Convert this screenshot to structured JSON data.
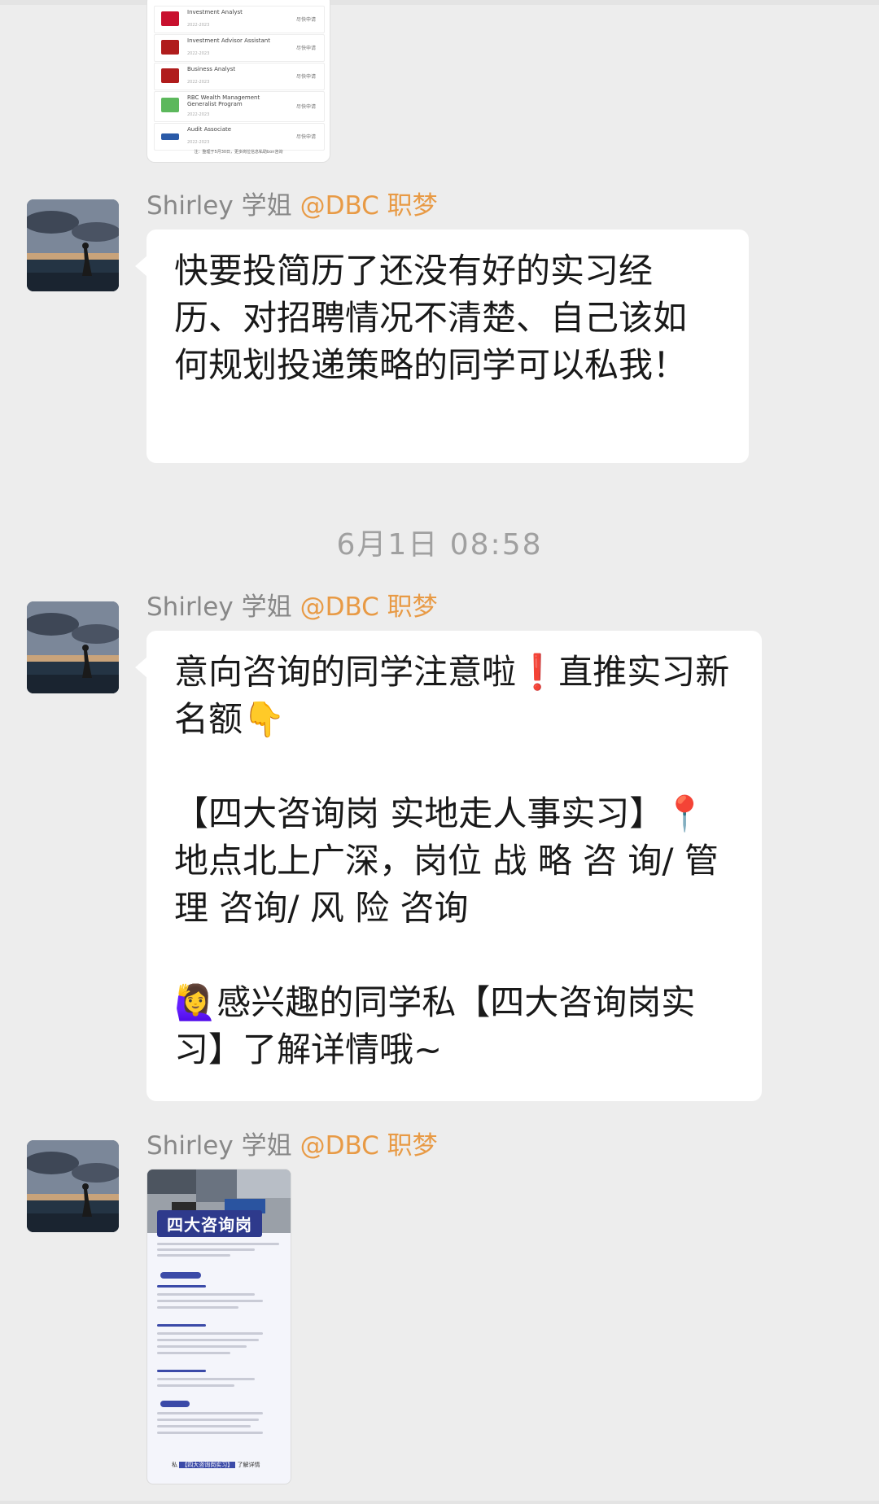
{
  "top_card": {
    "rows": [
      {
        "title": "Investment Analyst",
        "sub": "2022-2023",
        "action": "尽快申请",
        "logo_color": "#c8102e"
      },
      {
        "title": "Investment Advisor Assistant",
        "sub": "2022-2023",
        "action": "尽快申请",
        "logo_color": "#b01c1c"
      },
      {
        "title": "Business Analyst",
        "sub": "2022-2023",
        "action": "尽快申请",
        "logo_color": "#b01c1c"
      },
      {
        "title": "RBC Wealth Management Generalist Program",
        "sub": "2022-2023",
        "action": "尽快申请",
        "logo_color": "#5cb85c"
      },
      {
        "title": "Audit Associate",
        "sub": "2022-2023",
        "action": "尽快申请",
        "logo_color": "#2a5aa8"
      }
    ],
    "footer": "注：整理于5月30日，更多岗位信息私助bon咨询"
  },
  "messages": [
    {
      "sender": "Shirley 学姐",
      "tag": "@DBC 职梦",
      "text": "快要投简历了还没有好的实习经历、对招聘情况不清楚、自己该如何规划投递策略的同学可以私我！"
    },
    {
      "sender": "Shirley 学姐",
      "tag": "@DBC 职梦",
      "para1": "意向咨询的同学注意啦❗直推实习新名额👇",
      "para2": "【四大咨询岗 实地走人事实习】📍地点北上广深，岗位 战 略 咨 询/ 管 理 咨询/ 风 险 咨询",
      "para3": "🙋‍♀️感兴趣的同学私【四大咨询岗实习】了解详情哦~"
    },
    {
      "sender": "Shirley 学姐",
      "tag": "@DBC 职梦",
      "image": {
        "banner": "四大咨询岗",
        "cta_prefix": "私",
        "cta_highlight": "【四大咨询岗实习】",
        "cta_suffix": "了解详情"
      }
    }
  ],
  "timestamp": "6月1日 08:58"
}
